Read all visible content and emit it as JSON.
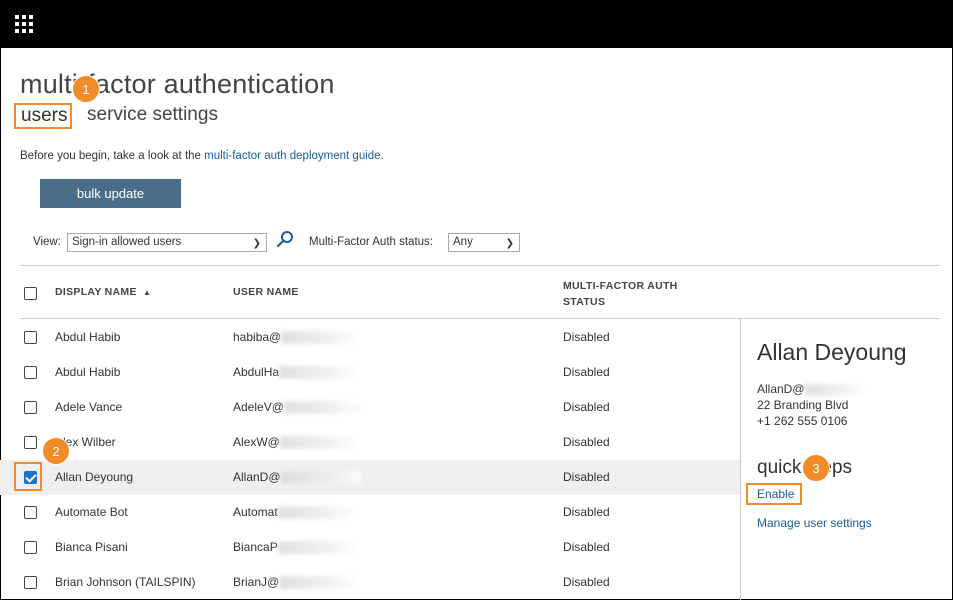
{
  "app": {
    "waffle_icon": "app-launcher-icon"
  },
  "page": {
    "title": "multi-factor authentication"
  },
  "tabs": {
    "users": "users",
    "service_settings": "service settings"
  },
  "intro": {
    "prefix": "Before you begin, take a look at the ",
    "link": "multi-factor auth deployment guide",
    "suffix": "."
  },
  "toolbar": {
    "bulk_update": "bulk update",
    "view_label": "View:",
    "view_value": "Sign-in allowed users",
    "status_label": "Multi-Factor Auth status:",
    "status_value": "Any"
  },
  "table": {
    "headers": {
      "display_name": "DISPLAY NAME",
      "sort_indicator": "▲",
      "user_name": "USER NAME",
      "mfa_status": "MULTI-FACTOR AUTH STATUS"
    },
    "rows": [
      {
        "name": "Abdul Habib",
        "user": "habiba@",
        "status": "Disabled",
        "checked": false
      },
      {
        "name": "Abdul Habib",
        "user": "AbdulHa",
        "status": "Disabled",
        "checked": false
      },
      {
        "name": "Adele Vance",
        "user": "AdeleV@",
        "status": "Disabled",
        "checked": false
      },
      {
        "name": "Alex Wilber",
        "user": "AlexW@",
        "status": "Disabled",
        "checked": false
      },
      {
        "name": "Allan Deyoung",
        "user": "AllanD@",
        "status": "Disabled",
        "checked": true
      },
      {
        "name": "Automate Bot",
        "user": "Automat",
        "status": "Disabled",
        "checked": false
      },
      {
        "name": "Bianca Pisani",
        "user": "BiancaP",
        "status": "Disabled",
        "checked": false
      },
      {
        "name": "Brian Johnson (TAILSPIN)",
        "user": "BrianJ@",
        "status": "Disabled",
        "checked": false
      }
    ]
  },
  "detail": {
    "name": "Allan Deyoung",
    "email_prefix": "AllanD@",
    "address": "22 Branding Blvd",
    "phone": "+1 262 555 0106",
    "quick_steps_title": "quick steps",
    "enable": "Enable",
    "manage": "Manage user settings"
  },
  "callouts": [
    "1",
    "2",
    "3"
  ],
  "colors": {
    "accent_orange": "#f28c28",
    "button_blue": "#4a6e88",
    "link_blue": "#1a5e9a",
    "checkbox_blue": "#1a73c9"
  }
}
